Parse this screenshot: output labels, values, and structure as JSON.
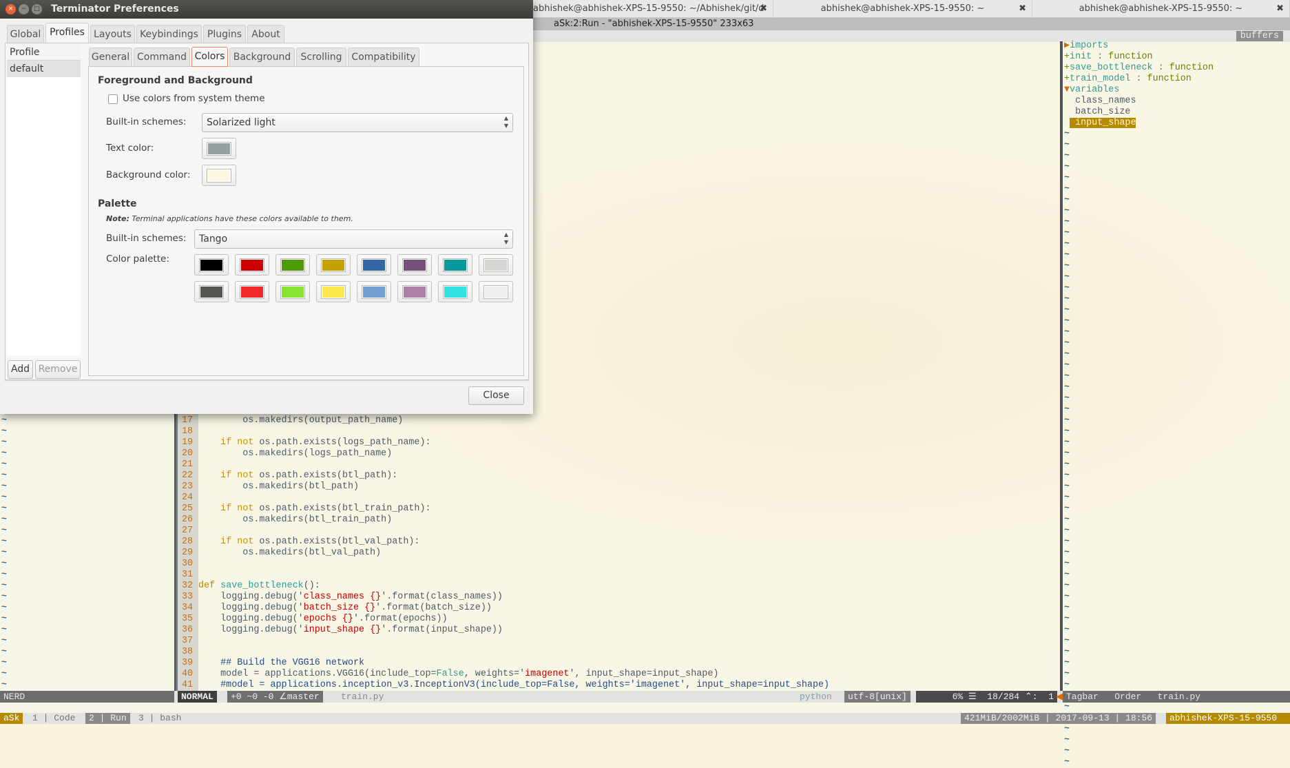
{
  "terminal": {
    "tabs": [
      {
        "label": "abhishek@abhishek-XPS-15-9550: ~/Abhishek/git/d"
      },
      {
        "label": "abhishek@abhishek-XPS-15-9550: ~"
      },
      {
        "label": "abhishek@abhishek-XPS-15-9550: ~"
      }
    ],
    "tab_close_icon": "✖",
    "title_line": "aSk:2:Run - \"abhishek-XPS-15-9550\"  233x63",
    "buffers_label": "buffers",
    "tagbar": [
      {
        "marker": "▶",
        "text": "imports",
        "cls": "fn"
      },
      {
        "marker": "+",
        "text": "init",
        "type": " : function"
      },
      {
        "marker": "+",
        "text": "save_bottleneck",
        "type": " : function"
      },
      {
        "marker": "+",
        "text": "train_model",
        "type": " : function"
      },
      {
        "marker": "▼",
        "text": "variables",
        "cls": "fn"
      },
      {
        "marker": " ",
        "text": " class_names"
      },
      {
        "marker": " ",
        "text": " batch_size"
      },
      {
        "marker": " ",
        "text": " input_shape",
        "selected": true
      }
    ],
    "code": [
      {
        "n": "17",
        "segs": [
          [
            "        os.makedirs(output_path_name)",
            "tx"
          ]
        ]
      },
      {
        "n": "18",
        "segs": []
      },
      {
        "n": "19",
        "segs": [
          [
            "    ",
            ""
          ],
          [
            "if",
            "kw"
          ],
          [
            " ",
            ""
          ],
          [
            "not",
            "kw"
          ],
          [
            " os.path.exists(logs_path_name):",
            "tx"
          ]
        ]
      },
      {
        "n": "20",
        "segs": [
          [
            "        os.makedirs(logs_path_name)",
            "tx"
          ]
        ]
      },
      {
        "n": "21",
        "segs": []
      },
      {
        "n": "22",
        "segs": [
          [
            "    ",
            ""
          ],
          [
            "if",
            "kw"
          ],
          [
            " ",
            ""
          ],
          [
            "not",
            "kw"
          ],
          [
            " os.path.exists(btl_path):",
            "tx"
          ]
        ]
      },
      {
        "n": "23",
        "segs": [
          [
            "        os.makedirs(btl_path)",
            "tx"
          ]
        ]
      },
      {
        "n": "24",
        "segs": []
      },
      {
        "n": "25",
        "segs": [
          [
            "    ",
            ""
          ],
          [
            "if",
            "kw"
          ],
          [
            " ",
            ""
          ],
          [
            "not",
            "kw"
          ],
          [
            " os.path.exists(btl_train_path):",
            "tx"
          ]
        ]
      },
      {
        "n": "26",
        "segs": [
          [
            "        os.makedirs(btl_train_path)",
            "tx"
          ]
        ]
      },
      {
        "n": "27",
        "segs": []
      },
      {
        "n": "28",
        "segs": [
          [
            "    ",
            ""
          ],
          [
            "if",
            "kw"
          ],
          [
            " ",
            ""
          ],
          [
            "not",
            "kw"
          ],
          [
            " os.path.exists(btl_val_path):",
            "tx"
          ]
        ]
      },
      {
        "n": "29",
        "segs": [
          [
            "        os.makedirs(btl_val_path)",
            "tx"
          ]
        ]
      },
      {
        "n": "30",
        "segs": []
      },
      {
        "n": "31",
        "segs": []
      },
      {
        "n": "32",
        "segs": [
          [
            "def",
            "kw2"
          ],
          [
            " ",
            ""
          ],
          [
            "save_bottleneck",
            "fn"
          ],
          [
            "():",
            "tx"
          ]
        ]
      },
      {
        "n": "33",
        "segs": [
          [
            "    logging.debug('",
            "tx"
          ],
          [
            "class_names {}",
            "st"
          ],
          [
            "'.format(class_names))",
            "tx"
          ]
        ]
      },
      {
        "n": "34",
        "segs": [
          [
            "    logging.debug('",
            "tx"
          ],
          [
            "batch_size {}",
            "st"
          ],
          [
            "'.format(batch_size))",
            "tx"
          ]
        ]
      },
      {
        "n": "35",
        "segs": [
          [
            "    logging.debug('",
            "tx"
          ],
          [
            "epochs {}",
            "st"
          ],
          [
            "'.format(epochs))",
            "tx"
          ]
        ]
      },
      {
        "n": "36",
        "segs": [
          [
            "    logging.debug('",
            "tx"
          ],
          [
            "input_shape {}",
            "st"
          ],
          [
            "'.format(input_shape))",
            "tx"
          ]
        ]
      },
      {
        "n": "37",
        "segs": []
      },
      {
        "n": "38",
        "segs": []
      },
      {
        "n": "39",
        "segs": [
          [
            "    ## Build the VGG16 network",
            "cm"
          ]
        ]
      },
      {
        "n": "40",
        "segs": [
          [
            "    model = applications.VGG16(include_top=",
            "tx"
          ],
          [
            "False",
            "bt"
          ],
          [
            ", weights='",
            "tx"
          ],
          [
            "imagenet",
            "st"
          ],
          [
            "', input_shape=input_shape)",
            "tx"
          ]
        ]
      },
      {
        "n": "41",
        "segs": [
          [
            "    #model = applications.inception_v3.InceptionV3(include_top=False, weights='imagenet', input_shape=input_shape)",
            "cm"
          ]
        ]
      }
    ],
    "status": {
      "nerd": "NERD",
      "mode": "NORMAL",
      "git": "+0 ~0 -0 ∠master",
      "file": "train.py",
      "filetype": "python",
      "encoding": "utf-8[unix]",
      "position": "6% ☰  18/284 ⌃:  1",
      "tagbar": "Tagbar   Order   train.py"
    },
    "tmux": {
      "session": "aSk",
      "windows": [
        {
          "index": "1",
          "name": "Code"
        },
        {
          "index": "2",
          "name": "Run",
          "active": true
        },
        {
          "index": "3",
          "name": "bash"
        }
      ],
      "right": "421MiB/2002MiB | 2017-09-13 | 18:56",
      "host": "abhishek-XPS-15-9550"
    },
    "colors": {
      "tmux_accent": "#b58900",
      "cursor_orange": "#e06c00"
    }
  },
  "dialog": {
    "title": "Terminator Preferences",
    "tabs": [
      "Global",
      "Profiles",
      "Layouts",
      "Keybindings",
      "Plugins",
      "About"
    ],
    "active_tab": "Profiles",
    "profiles_header": "Profile",
    "profiles": [
      "default"
    ],
    "add_label": "Add",
    "remove_label": "Remove",
    "subtabs": [
      "General",
      "Command",
      "Colors",
      "Background",
      "Scrolling",
      "Compatibility"
    ],
    "active_subtab": "Colors",
    "fg_bg": {
      "heading": "Foreground and Background",
      "use_system_label": "Use colors from system theme",
      "use_system_checked": false,
      "schemes_label": "Built-in schemes:",
      "scheme_value": "Solarized light",
      "text_color_label": "Text color:",
      "text_color": "#93a1a1",
      "bg_color_label": "Background color:",
      "bg_color": "#fdf6e3"
    },
    "palette": {
      "heading": "Palette",
      "note_bold": "Note:",
      "note": " Terminal applications have these colors available to them.",
      "schemes_label": "Built-in schemes:",
      "scheme_value": "Tango",
      "palette_label": "Color palette:",
      "colors": [
        "#000000",
        "#cc0000",
        "#4e9a06",
        "#c4a000",
        "#3465a4",
        "#75507b",
        "#06989a",
        "#d3d7cf",
        "#555753",
        "#ef2929",
        "#8ae234",
        "#fce94f",
        "#729fcf",
        "#ad7fa8",
        "#34e2e2",
        "#eeeeec"
      ]
    },
    "close_label": "Close"
  }
}
